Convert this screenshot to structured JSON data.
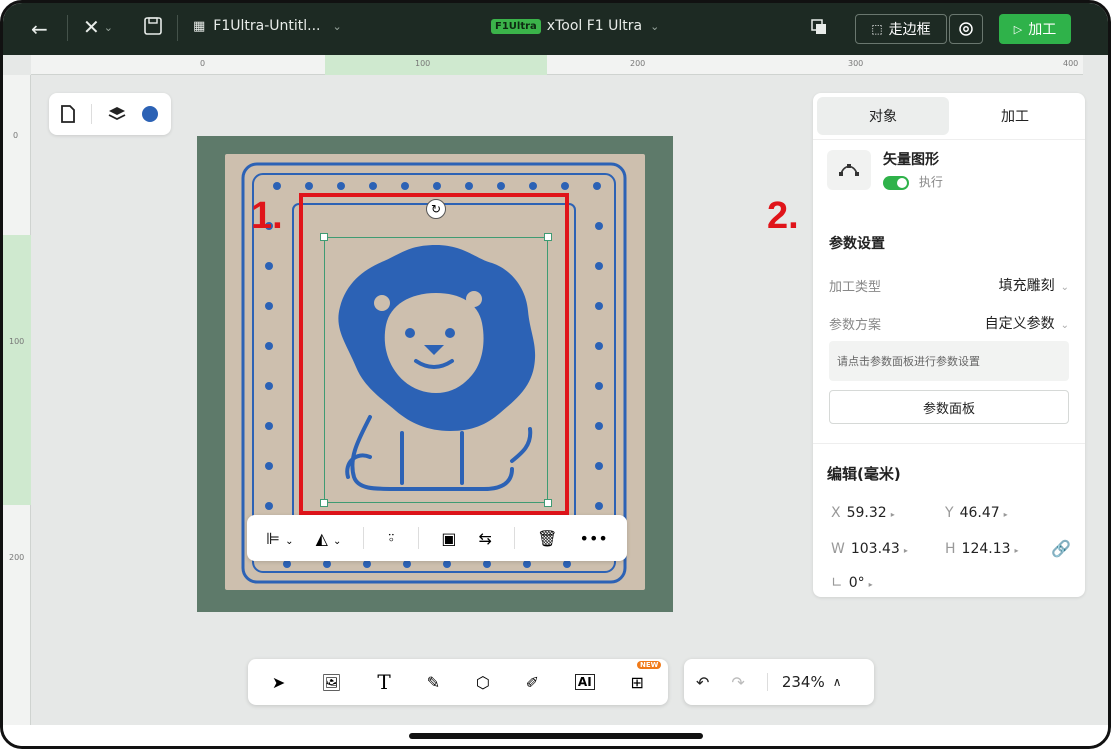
{
  "topbar": {
    "project_title": "F1Ultra-Untitl...",
    "device_badge": "F1Ultra",
    "device_name": "xTool F1 Ultra",
    "frame_button": "走边框",
    "process_button": "加工"
  },
  "ruler": {
    "top_marks": [
      "0",
      "100",
      "200",
      "300",
      "400"
    ],
    "left_marks": [
      "0",
      "100",
      "200"
    ]
  },
  "annotations": {
    "marker_1": "1.",
    "marker_2": "2."
  },
  "panel": {
    "tabs": [
      "对象",
      "加工"
    ],
    "object_type": "矢量图形",
    "execute_label": "执行",
    "param_section_title": "参数设置",
    "process_type_label": "加工类型",
    "process_type_value": "填充雕刻",
    "param_scheme_label": "参数方案",
    "param_scheme_value": "自定义参数",
    "hint_text": "请点击参数面板进行参数设置",
    "param_panel_button": "参数面板",
    "edit_title": "编辑(毫米)",
    "x_label": "X",
    "x_value": "59.32",
    "y_label": "Y",
    "y_value": "46.47",
    "w_label": "W",
    "w_value": "103.43",
    "h_label": "H",
    "h_value": "124.13",
    "angle_value": "0°"
  },
  "bottom": {
    "new_badge": "NEW",
    "zoom_value": "234%"
  },
  "colors": {
    "topbar_bg": "#1d2a23",
    "accent_green": "#2fb24a",
    "annotation_red": "#e0141a",
    "lion_blue": "#2c62b5"
  }
}
